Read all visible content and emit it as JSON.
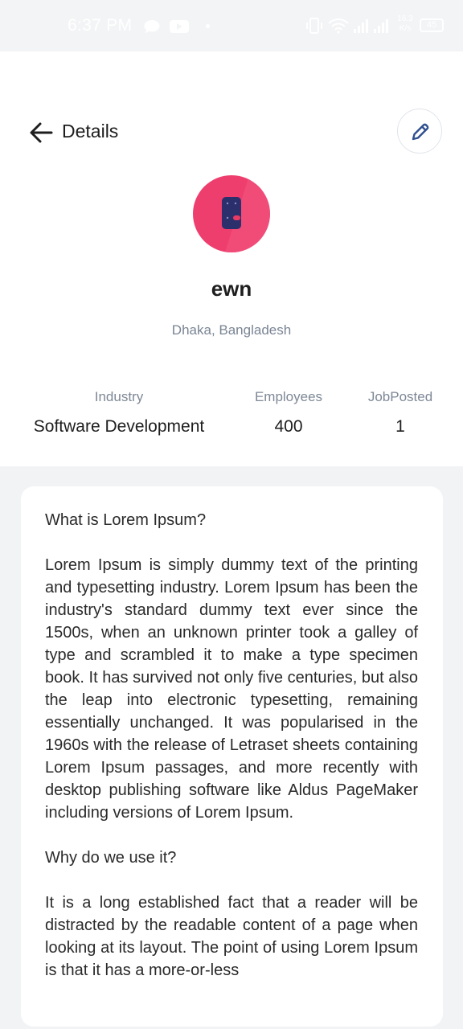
{
  "status_bar": {
    "time": "6:37 PM",
    "network_speed_top": "16.3",
    "network_speed_unit": "K/s",
    "battery": "45"
  },
  "header": {
    "title": "Details",
    "back_icon": "arrow-left-icon",
    "edit_icon": "pencil-icon"
  },
  "company": {
    "name": "ewn",
    "location": "Dhaka, Bangladesh",
    "logo_icon": "app-logo-icon"
  },
  "stats": [
    {
      "label": "Industry",
      "value": "Software Development"
    },
    {
      "label": "Employees",
      "value": "400"
    },
    {
      "label": "JobPosted",
      "value": "1"
    }
  ],
  "description": {
    "heading1": "What is Lorem Ipsum?",
    "paragraph1": "Lorem Ipsum is simply dummy text of the printing and typesetting industry. Lorem Ipsum has been the industry's standard dummy text ever since the 1500s, when an unknown printer took a galley of type and scrambled it to make a type specimen book. It has survived not only five centuries, but also the leap into electronic typesetting, remaining essentially unchanged. It was popularised in the 1960s with the release of Letraset sheets containing Lorem Ipsum passages, and more recently with desktop publishing software like Aldus PageMaker including versions of Lorem Ipsum.",
    "heading2": "Why do we use it?",
    "paragraph2": "It is a long established fact that a reader will be distracted by the readable content of a page when looking at its layout. The point of using Lorem Ipsum is that it has a more-or-less"
  },
  "colors": {
    "accent": "#ee3e6d",
    "edit_icon": "#2f4f8f",
    "background": "#f2f3f5"
  }
}
